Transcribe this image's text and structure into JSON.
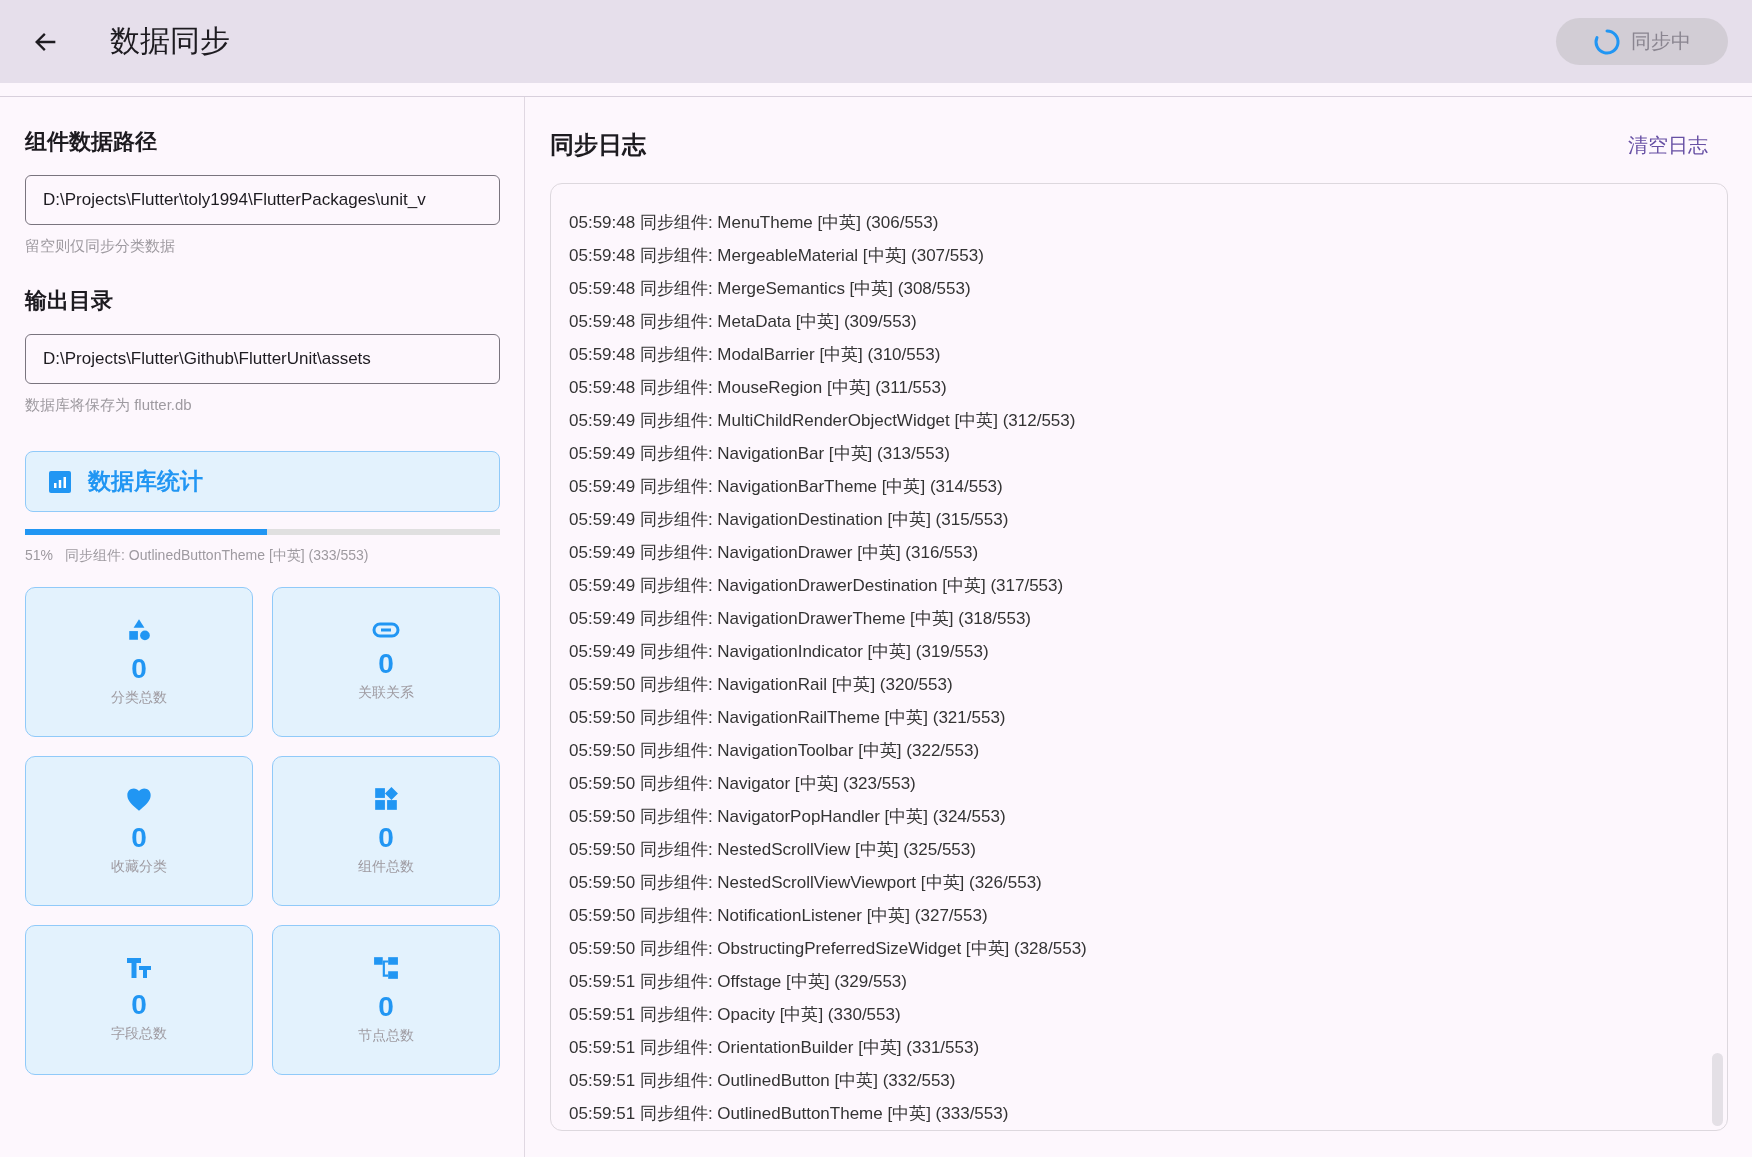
{
  "app_bar": {
    "title": "数据同步",
    "sync_button": {
      "label": "同步中",
      "busy": true
    }
  },
  "source": {
    "title": "组件数据路径",
    "value": "D:\\Projects\\Flutter\\toly1994\\FlutterPackages\\unit_v",
    "hint": "留空则仅同步分类数据"
  },
  "output": {
    "title": "输出目录",
    "value": "D:\\Projects\\Flutter\\Github\\FlutterUnit\\assets",
    "hint": "数据库将保存为 flutter.db"
  },
  "stats_button": {
    "label": "数据库统计"
  },
  "progress": {
    "level": 0.51,
    "percent": "51%",
    "message": "同步组件: OutlinedButtonTheme [中英] (333/553)"
  },
  "stats": [
    {
      "value": "0",
      "label": "分类总数"
    },
    {
      "value": "0",
      "label": "关联关系"
    },
    {
      "value": "0",
      "label": "收藏分类"
    },
    {
      "value": "0",
      "label": "组件总数"
    },
    {
      "value": "0",
      "label": "字段总数"
    },
    {
      "value": "0",
      "label": "节点总数"
    }
  ],
  "log": {
    "title": "同步日志",
    "clear_button": "清空日志",
    "lines": [
      "05:59:48 同步组件: MenuTheme [中英] (306/553)",
      "05:59:48 同步组件: MergeableMaterial [中英] (307/553)",
      "05:59:48 同步组件: MergeSemantics [中英] (308/553)",
      "05:59:48 同步组件: MetaData [中英] (309/553)",
      "05:59:48 同步组件: ModalBarrier [中英] (310/553)",
      "05:59:48 同步组件: MouseRegion [中英] (311/553)",
      "05:59:49 同步组件: MultiChildRenderObjectWidget [中英] (312/553)",
      "05:59:49 同步组件: NavigationBar [中英] (313/553)",
      "05:59:49 同步组件: NavigationBarTheme [中英] (314/553)",
      "05:59:49 同步组件: NavigationDestination [中英] (315/553)",
      "05:59:49 同步组件: NavigationDrawer [中英] (316/553)",
      "05:59:49 同步组件: NavigationDrawerDestination [中英] (317/553)",
      "05:59:49 同步组件: NavigationDrawerTheme [中英] (318/553)",
      "05:59:49 同步组件: NavigationIndicator [中英] (319/553)",
      "05:59:50 同步组件: NavigationRail [中英] (320/553)",
      "05:59:50 同步组件: NavigationRailTheme [中英] (321/553)",
      "05:59:50 同步组件: NavigationToolbar [中英] (322/553)",
      "05:59:50 同步组件: Navigator [中英] (323/553)",
      "05:59:50 同步组件: NavigatorPopHandler [中英] (324/553)",
      "05:59:50 同步组件: NestedScrollView [中英] (325/553)",
      "05:59:50 同步组件: NestedScrollViewViewport [中英] (326/553)",
      "05:59:50 同步组件: NotificationListener [中英] (327/553)",
      "05:59:50 同步组件: ObstructingPreferredSizeWidget [中英] (328/553)",
      "05:59:51 同步组件: Offstage [中英] (329/553)",
      "05:59:51 同步组件: Opacity [中英] (330/553)",
      "05:59:51 同步组件: OrientationBuilder [中英] (331/553)",
      "05:59:51 同步组件: OutlinedButton [中英] (332/553)",
      "05:59:51 同步组件: OutlinedButtonTheme [中英] (333/553)"
    ]
  }
}
